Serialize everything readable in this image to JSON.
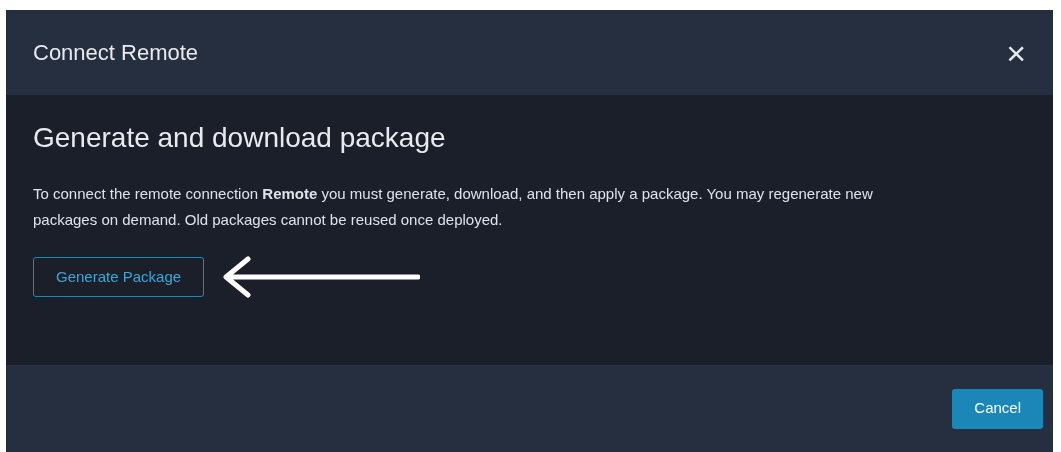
{
  "dialog": {
    "title": "Connect Remote",
    "close": "×"
  },
  "heading": "Generate and download package",
  "description": "To connect the remote connection **Remote** you must generate, download, and then apply a package. You may regenerate new packages on demand. Old packages cannot be reused once deployed.",
  "generate_button": "Generate Package",
  "footer_buttons": [
    "Cancel"
  ]
}
